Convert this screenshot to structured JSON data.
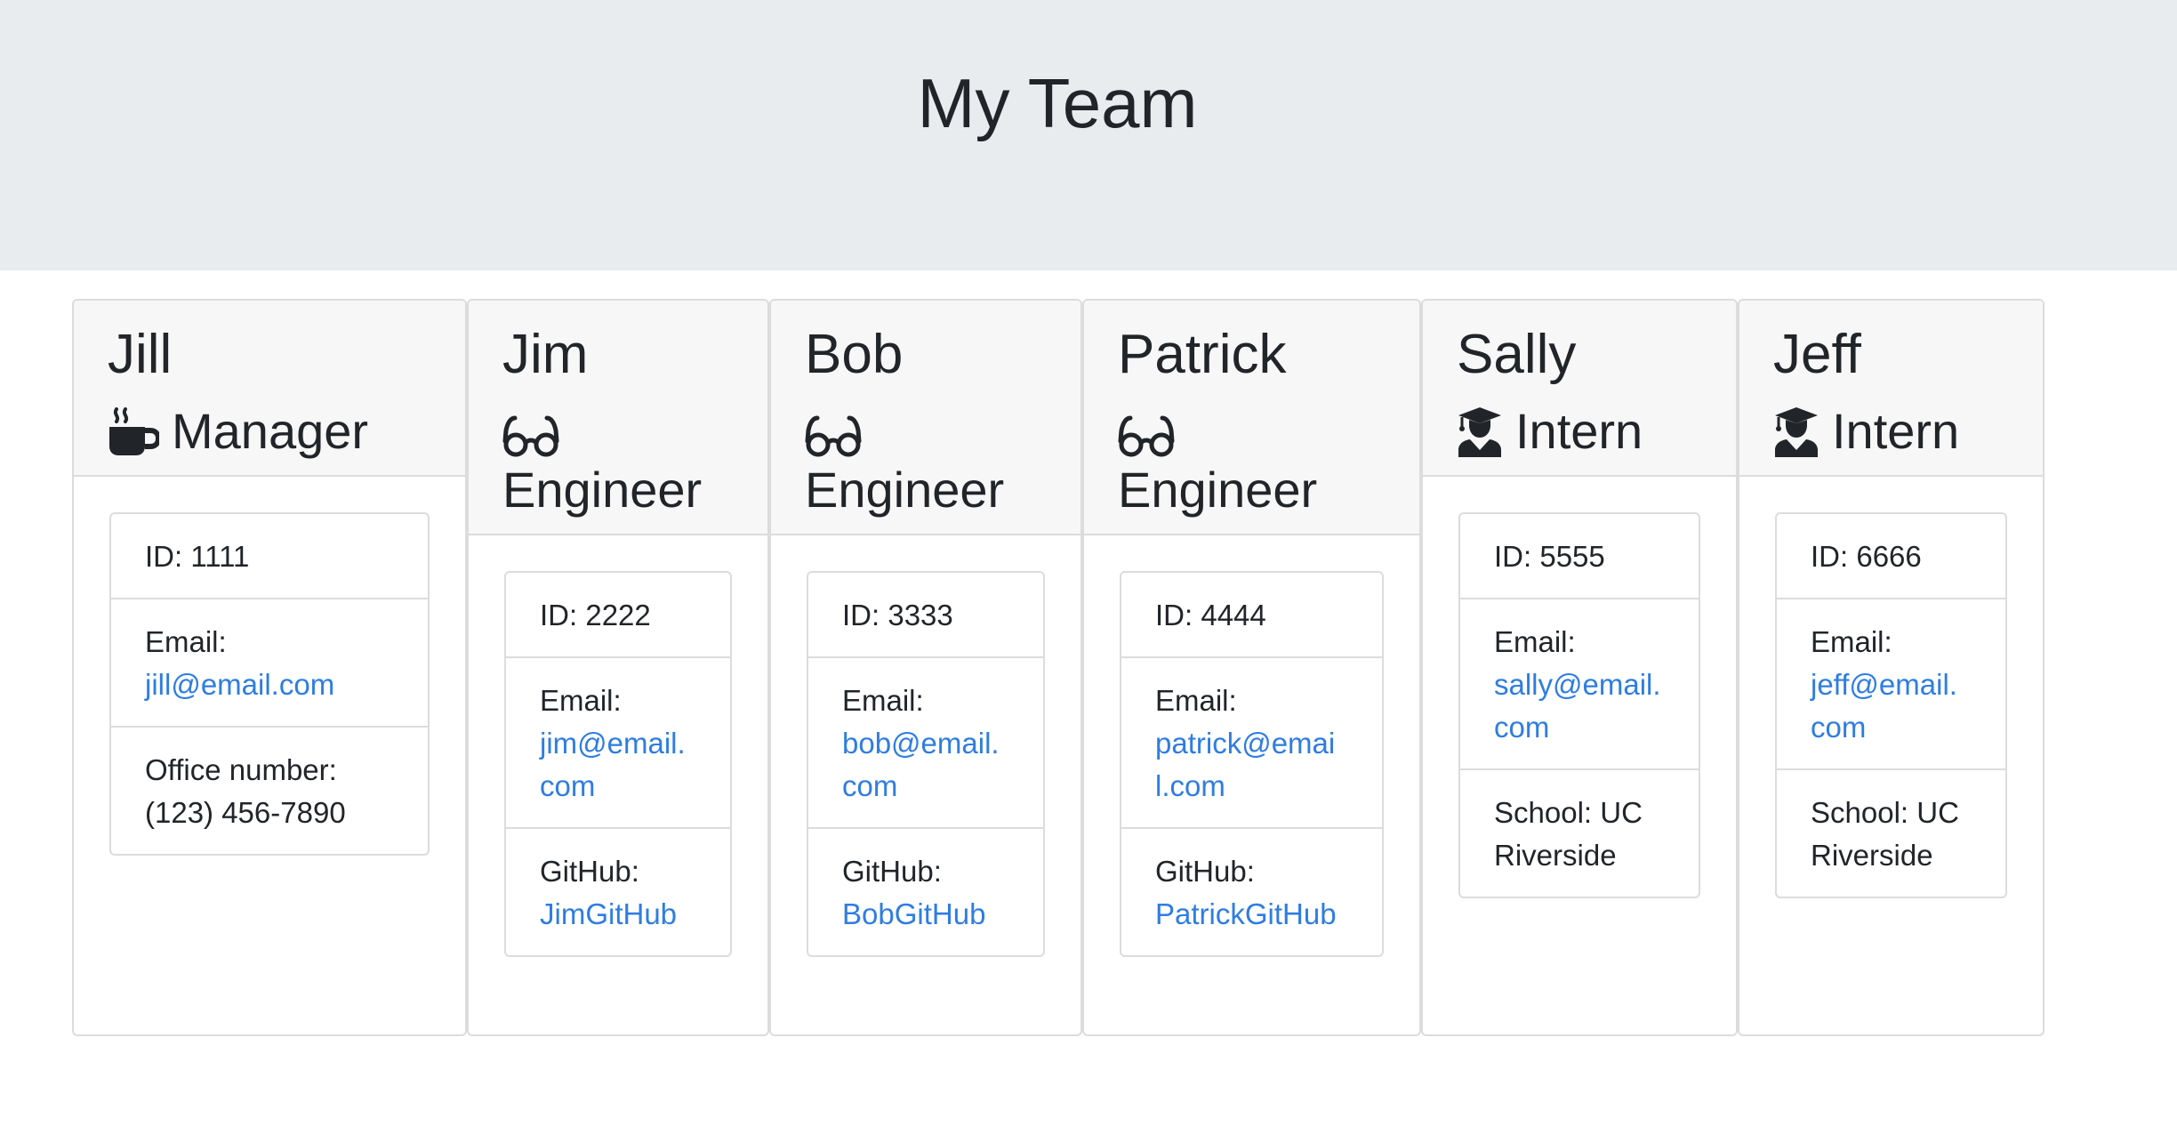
{
  "header": {
    "title": "My Team"
  },
  "cards": [
    {
      "name": "Jill",
      "role": "Manager",
      "icon": "coffee-icon",
      "id_label": "ID: 1111",
      "email_label": "Email:",
      "email": "jill@email.com",
      "extra_label": "Office number:",
      "extra_value": "(123) 456-7890",
      "extra_is_link": false
    },
    {
      "name": "Jim",
      "role": "Engineer",
      "icon": "glasses-icon",
      "id_label": "ID: 2222",
      "email_label": "Email:",
      "email": "jim@email.com",
      "extra_label": "GitHub:",
      "extra_value": "JimGitHub",
      "extra_is_link": true
    },
    {
      "name": "Bob",
      "role": "Engineer",
      "icon": "glasses-icon",
      "id_label": "ID: 3333",
      "email_label": "Email:",
      "email": "bob@email.com",
      "extra_label": "GitHub:",
      "extra_value": "BobGitHub",
      "extra_is_link": true
    },
    {
      "name": "Patrick",
      "role": "Engineer",
      "icon": "glasses-icon",
      "id_label": "ID: 4444",
      "email_label": "Email:",
      "email": "patrick@email.com",
      "extra_label": "GitHub:",
      "extra_value": "PatrickGitHub",
      "extra_is_link": true
    },
    {
      "name": "Sally",
      "role": "Intern",
      "icon": "graduate-icon",
      "id_label": "ID: 5555",
      "email_label": "Email:",
      "email": "sally@email.com",
      "extra_label": "School:",
      "extra_value": "UC Riverside",
      "extra_is_link": false
    },
    {
      "name": "Jeff",
      "role": "Intern",
      "icon": "graduate-icon",
      "id_label": "ID: 6666",
      "email_label": "Email:",
      "email": "jeff@email.com",
      "extra_label": "School:",
      "extra_value": "UC Riverside",
      "extra_is_link": false
    }
  ],
  "colors": {
    "link": "#2f7de1",
    "jumbotron": "#e9ecef",
    "card_header": "#f7f7f7",
    "text": "#212529"
  }
}
